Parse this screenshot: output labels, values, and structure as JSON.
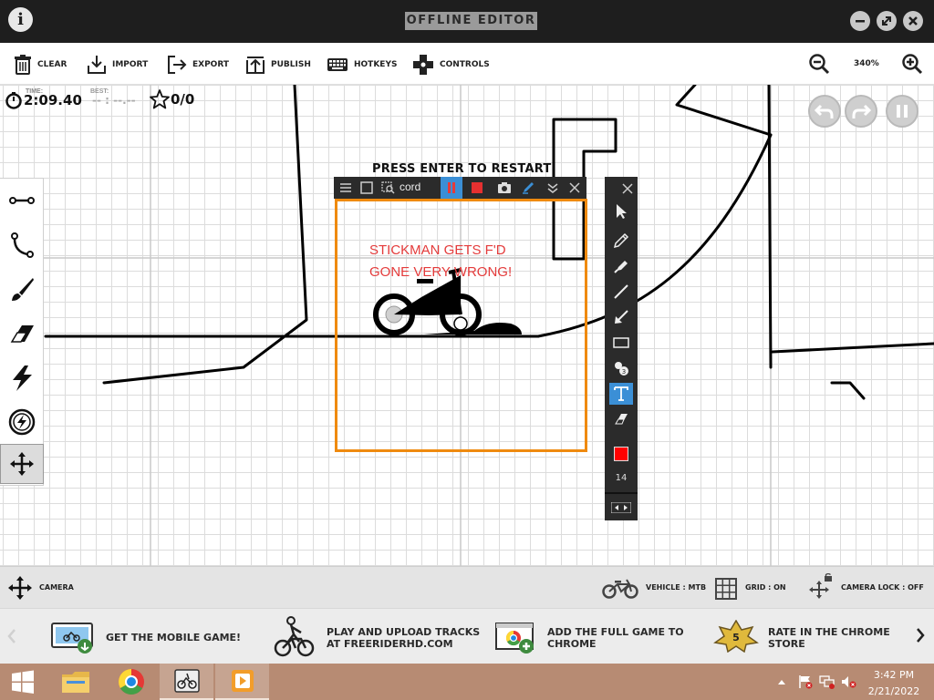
{
  "window": {
    "title": "OFFLINE EDITOR",
    "info_icon": "i",
    "buttons": [
      "minimize-icon",
      "maximize-icon",
      "close-icon"
    ]
  },
  "toolbar": {
    "clear": "CLEAR",
    "import": "IMPORT",
    "export": "EXPORT",
    "publish": "PUBLISH",
    "hotkeys": "HOTKEYS",
    "controls": "CONTROLS",
    "zoom": "340%"
  },
  "hud": {
    "time_label": "TIME:",
    "time": "2:09.40",
    "best_label": "BEST:",
    "best": "-- : --.--",
    "stars": "0/0"
  },
  "canvas": {
    "message": "PRESS ENTER TO RESTART"
  },
  "left_tools": [
    "line-tool-icon",
    "curve-tool-icon",
    "brush-tool-icon",
    "eraser-tool-icon",
    "powerup-tool-icon",
    "target-tool-icon",
    "camera-move-tool-icon"
  ],
  "recorder": {
    "label": "cord",
    "annotation_line1": "STICKMAN GETS F'D",
    "annotation_line2": "GONE VERY WRONG!",
    "frame_color": "#ef8a0f",
    "text_color": "#e43b3b"
  },
  "annotate_panel": {
    "active_tool": "text-tool",
    "color": "#ff0000",
    "size": "14"
  },
  "statusbar": {
    "mode": "CAMERA",
    "vehicle": "VEHICLE : MTB",
    "grid": "GRID : ON",
    "camera_lock": "CAMERA LOCK : OFF"
  },
  "promos": [
    {
      "line1": "GET THE MOBILE GAME!",
      "line2": ""
    },
    {
      "line1": "PLAY AND UPLOAD TRACKS",
      "line2": "AT FREERIDERHD.COM"
    },
    {
      "line1": "ADD THE FULL GAME TO",
      "line2": "CHROME"
    },
    {
      "line1": "RATE IN THE CHROME",
      "line2": "STORE"
    }
  ],
  "rating_badge": "5",
  "taskbar": {
    "time": "3:42 PM",
    "date": "2/21/2022"
  }
}
